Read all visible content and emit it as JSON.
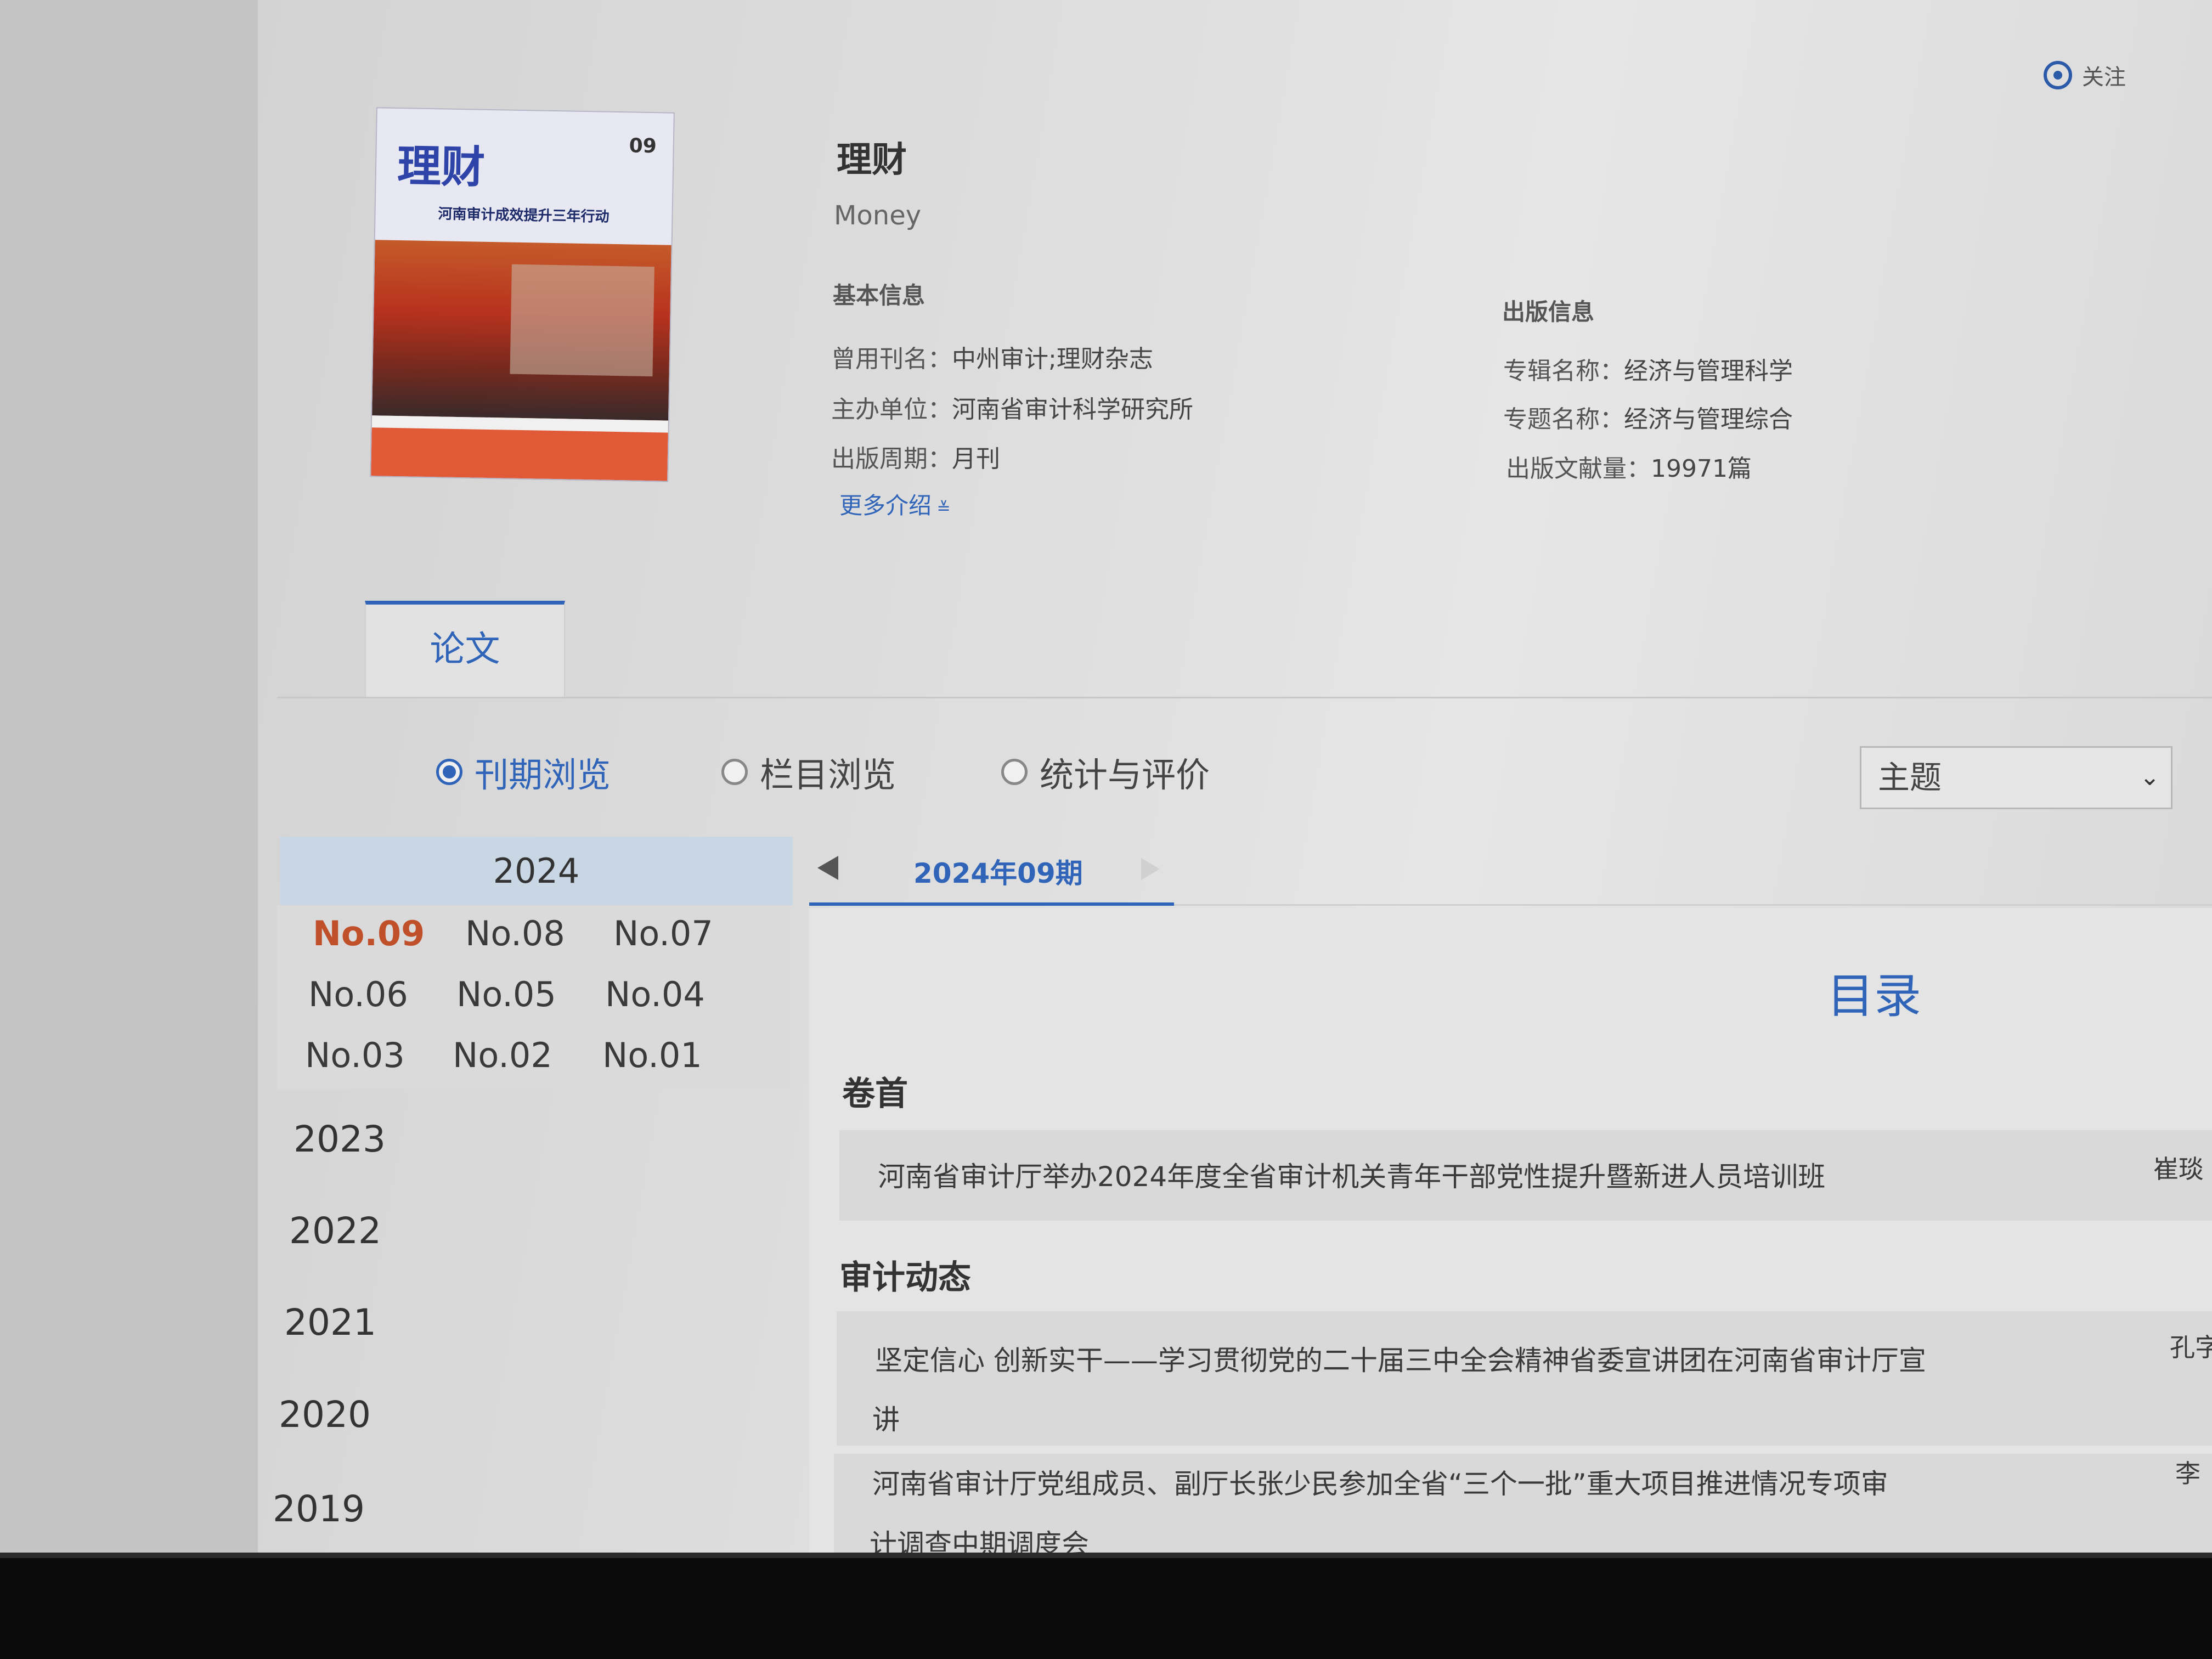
{
  "header": {
    "follow_label": "关注",
    "journal_title": "理财",
    "journal_subtitle": "Money"
  },
  "cover": {
    "logo_text": "理财",
    "issue_text": "09",
    "headline": "河南审计成效提升三年行动"
  },
  "basic_info": {
    "heading": "基本信息",
    "items": [
      {
        "key": "曾用刊名：",
        "value": "中州审计;理财杂志"
      },
      {
        "key": "主办单位：",
        "value": "河南省审计科学研究所"
      },
      {
        "key": "出版周期：",
        "value": "月刊"
      }
    ],
    "more_label": "更多介绍"
  },
  "pub_info": {
    "heading": "出版信息",
    "items": [
      {
        "key": "专辑名称：",
        "value": "经济与管理科学"
      },
      {
        "key": "专题名称：",
        "value": "经济与管理综合"
      },
      {
        "key": "出版文献量：",
        "value": "19971篇"
      }
    ]
  },
  "tabs": [
    {
      "label": "论文",
      "active": true
    }
  ],
  "browse_modes": [
    {
      "label": "刊期浏览",
      "selected": true
    },
    {
      "label": "栏目浏览",
      "selected": false
    },
    {
      "label": "统计与评价",
      "selected": false
    }
  ],
  "sort_select": {
    "value": "主题"
  },
  "years": {
    "current_year": "2024",
    "issues": [
      "No.09",
      "No.08",
      "No.07",
      "No.06",
      "No.05",
      "No.04",
      "No.03",
      "No.02",
      "No.01"
    ],
    "current_issue": "No.09",
    "other_years": [
      "2023",
      "2022",
      "2021",
      "2020",
      "2019"
    ]
  },
  "issue_nav": {
    "current": "2024年09期"
  },
  "toc": {
    "title": "目录",
    "sections": [
      {
        "name": "卷首",
        "articles": [
          {
            "title": "河南省审计厅举办2024年度全省审计机关青年干部党性提升暨新进人员培训班",
            "author": "崔琰"
          }
        ]
      },
      {
        "name": "审计动态",
        "articles": [
          {
            "title_line1": "坚定信心 创新实干——学习贯彻党的二十届三中全会精神省委宣讲团在河南省审计厅宣",
            "title_line2": "讲",
            "author": "孔字"
          },
          {
            "title_line1": "河南省审计厅党组成员、副厅长张少民参加全省“三个一批”重大项目推进情况专项审",
            "title_line2": "计调查中期调度会",
            "author": "李"
          }
        ]
      }
    ]
  },
  "colors": {
    "accent": "#2f64b8",
    "current_issue": "#c0502a"
  }
}
